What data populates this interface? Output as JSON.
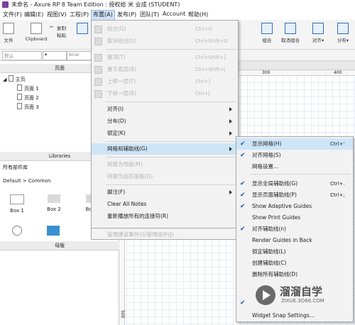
{
  "titlebar": {
    "text": "未命名 - Axure RP 8 Team Edition : 授权给 米 业成 (STUDENT)"
  },
  "menubar": [
    "文件(F)",
    "编辑(E)",
    "视图(V)",
    "工程(P)",
    "布置(A)",
    "发布(P)",
    "团队(T)",
    "Account",
    "帮助(H)"
  ],
  "toolbar": {
    "file": "文件",
    "clipboard": "Clipboard",
    "paste_small": [
      "✂",
      "复制",
      "粘贴"
    ],
    "combine": "组合",
    "uncombine": "取消组合",
    "align": "对齐▾",
    "distribute": "分布▾"
  },
  "stylebar": {
    "style": "默认",
    "font": "Arial"
  },
  "pages_panel": {
    "header": "页面",
    "root": "主页",
    "pages": [
      "页面 1",
      "页面 2",
      "页面 3"
    ]
  },
  "libraries_panel": {
    "header": "Libraries",
    "all": "所有部件库",
    "group": "Default > Common",
    "items": [
      "Box 1",
      "Box 2",
      "Bo"
    ]
  },
  "masters_panel": {
    "header": "母版"
  },
  "ruler": {
    "marks": [
      "300",
      "400"
    ],
    "left_mark": "500"
  },
  "arrange_menu": {
    "disabled_top": [
      {
        "label": "组合(G)",
        "shortcut": "Ctrl+G"
      },
      {
        "label": "取消组合(U)",
        "shortcut": "Ctrl+Shift+G"
      }
    ],
    "disabled_order": [
      {
        "label": "置顶(T)",
        "shortcut": "Ctrl+Shift+]"
      },
      {
        "label": "置于底层(B)",
        "shortcut": "Ctrl+Shift+["
      },
      {
        "label": "上移一层(F)",
        "shortcut": "Ctrl+]"
      },
      {
        "label": "下移一层(B)",
        "shortcut": "Ctrl+["
      }
    ],
    "submenus": [
      "对齐(I)",
      "分布(D)",
      "锁定(K)"
    ],
    "grid": "网格和辅助线(G)",
    "disabled_mid": [
      "转换为母版(M)",
      "转换为动态面板(D)"
    ],
    "footnote": "脚注(F)",
    "clear_notes": "Clear All Notes",
    "reconnect": "重新播放所有的连接符(R)",
    "disabled_bottom": "管理建该事件(I)/管理组件(J)"
  },
  "grid_menu": {
    "items": [
      {
        "label": "显示网格(H)",
        "shortcut": "Ctrl+'",
        "checked": true
      },
      {
        "label": "对齐网格(S)",
        "shortcut": "",
        "checked": true
      },
      {
        "label": "网格设置...",
        "shortcut": "",
        "checked": false
      },
      {
        "label": "显示全局辅助线(G)",
        "shortcut": "Ctrl+.",
        "checked": true
      },
      {
        "label": "显示页面辅助线(P)",
        "shortcut": "Ctrl+,",
        "checked": true
      },
      {
        "label": "Show Adaptive Guides",
        "shortcut": "",
        "checked": true
      },
      {
        "label": "Show Print Guides",
        "shortcut": "",
        "checked": false
      },
      {
        "label": "对齐辅助线(n)",
        "shortcut": "",
        "checked": true
      },
      {
        "label": "Render Guides in Back",
        "shortcut": "",
        "checked": false
      },
      {
        "label": "锁定辅助线(L)",
        "shortcut": "",
        "checked": false
      },
      {
        "label": "创建辅助线(C)",
        "shortcut": "",
        "checked": false
      },
      {
        "label": "删除所有辅助线(D)",
        "shortcut": "",
        "checked": false
      }
    ],
    "last": "Widget Snap Settings..."
  },
  "watermark": {
    "title": "溜溜自学",
    "sub": "ZIXUE.3D66.COM"
  },
  "colors": {
    "highlight": "#cde5f7",
    "check": "#1a5aa8",
    "accent": "#2c6fbf"
  }
}
